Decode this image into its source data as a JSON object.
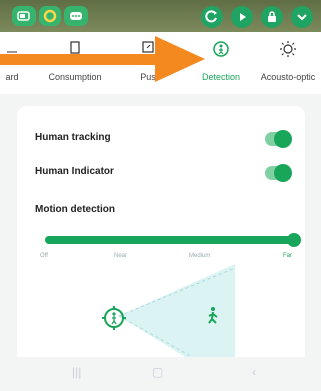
{
  "tabs": [
    {
      "label": "ard",
      "icon": "card-icon"
    },
    {
      "label": "Consumption",
      "icon": "clipboard-icon"
    },
    {
      "label": "Pus",
      "icon": "push-icon"
    },
    {
      "label": "Detection",
      "icon": "detection-icon",
      "active": true
    },
    {
      "label": "Acousto-optic",
      "icon": "sun-light-icon"
    }
  ],
  "settings": {
    "human_tracking": {
      "label": "Human tracking",
      "on": true
    },
    "human_indicator": {
      "label": "Human Indicator",
      "on": true
    },
    "motion_detection": {
      "label": "Motion detection",
      "levels": [
        "Off",
        "Near",
        "Medium",
        "Far"
      ],
      "selected": "Far"
    }
  },
  "colors": {
    "accent": "#17a65a",
    "annotation_arrow": "#f4891f"
  }
}
